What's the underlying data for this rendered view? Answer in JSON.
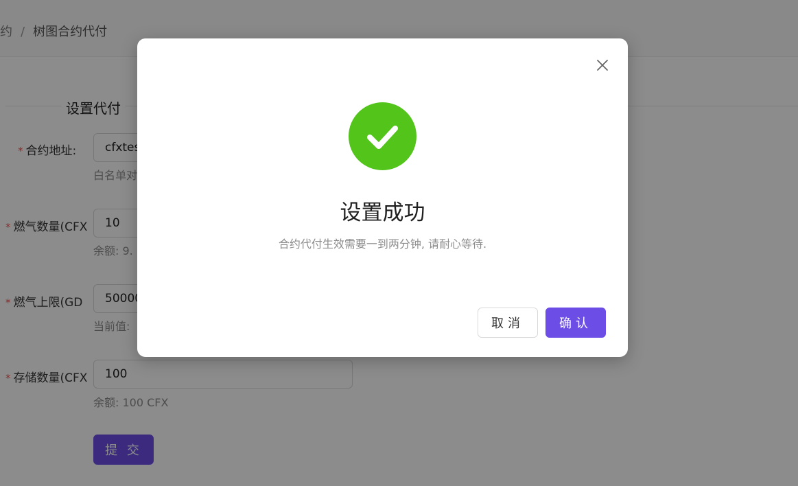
{
  "breadcrumb": {
    "parent": "约",
    "separator": "/",
    "current": "树图合约代付"
  },
  "form": {
    "section_title": "设置代付",
    "required_mark": "*",
    "fields": [
      {
        "label": "合约地址:",
        "value": "cfxtes",
        "help": "白名单对"
      },
      {
        "label": "燃气数量(CFX",
        "value": "10",
        "help": "余额: 9."
      },
      {
        "label": "燃气上限(GD",
        "value": "50000",
        "help": "当前值:"
      },
      {
        "label": "存储数量(CFX",
        "value": "100",
        "help": "余额: 100 CFX"
      }
    ],
    "submit_label": "提 交"
  },
  "modal": {
    "close_glyph": "×",
    "title": "设置成功",
    "description": "合约代付生效需要一到两分钟, 请耐心等待.",
    "cancel_label": "取消",
    "ok_label": "确认"
  },
  "colors": {
    "primary": "#6c4de6",
    "success": "#52c41a",
    "required": "#ff4d4f"
  }
}
